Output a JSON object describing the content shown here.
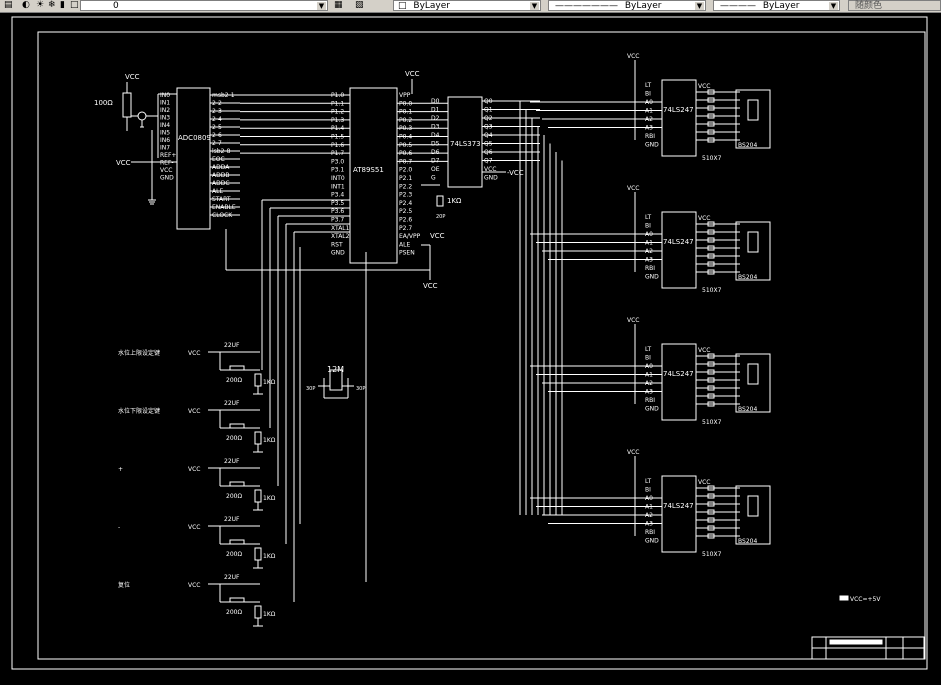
{
  "toolbar": {
    "layer_value": "0",
    "color_value": "ByLayer",
    "linetype_value": "ByLayer",
    "lineweight_value": "ByLayer",
    "plotstyle_value": "随颜色"
  },
  "schematic": {
    "adc": {
      "name": "ADC0809",
      "left_pins": [
        "IN0",
        "IN1",
        "IN2",
        "IN3",
        "IN4",
        "IN5",
        "IN6",
        "IN7",
        "REF+",
        "REF-",
        "VCC",
        "GND"
      ],
      "right_pins": [
        "msb2-1",
        "2-2",
        "2-3",
        "2-4",
        "2-5",
        "2-6",
        "2-7",
        "lsb2-8",
        "EOC",
        "ADDA",
        "ADDB",
        "ADDC",
        "ALE",
        "START",
        "ENABLE",
        "CLOCK"
      ]
    },
    "mcu": {
      "name": "AT89S51",
      "left_pins": [
        "P1.0",
        "P1.1",
        "P1.2",
        "P1.3",
        "P1.4",
        "P1.5",
        "P1.6",
        "P1.7",
        "P3.0",
        "P3.1",
        "INT0",
        "INT1",
        "P3.4",
        "P3.5",
        "P3.6",
        "P3.7",
        "XTAL1",
        "XTAL2",
        "RST",
        "GND"
      ],
      "right_pins": [
        "VPP",
        "P0.0",
        "P0.1",
        "P0.2",
        "P0.3",
        "P0.4",
        "P0.5",
        "P0.6",
        "P0.7",
        "P2.0",
        "P2.1",
        "P2.2",
        "P2.3",
        "P2.4",
        "P2.5",
        "P2.6",
        "P2.7",
        "EA/VPP",
        "ALE",
        "PSEN"
      ]
    },
    "latch": {
      "name": "74LS373",
      "in_pins": [
        "D0",
        "D1",
        "D2",
        "D3",
        "D4",
        "D5",
        "D6",
        "D7",
        "OE",
        "G"
      ],
      "out_pins": [
        "Q0",
        "Q1",
        "Q2",
        "Q3",
        "Q4",
        "Q5",
        "Q6",
        "Q7",
        "VCC",
        "GND"
      ]
    },
    "decoder": {
      "name": "74LS247",
      "pins": [
        "LT",
        "BI",
        "A0",
        "A1",
        "A2",
        "A3",
        "RBI",
        "GND"
      ],
      "vcc": "VCC",
      "resistor": "510X7",
      "display": "BS204"
    },
    "pot_resistor": "100Ω",
    "pull_resistor": "1KΩ",
    "cap_label": "22UF",
    "key_resistor": "200Ω",
    "crystal": "12M",
    "crystal_caps": [
      "30P",
      "30P"
    ],
    "ea_cap": "20P",
    "vcc": "VCC",
    "vcc_out": "-VCC",
    "buttons": [
      "水位上限设定键",
      "水位下限设定键",
      "+",
      "-",
      "复位"
    ],
    "note": "VCC=+5V"
  }
}
